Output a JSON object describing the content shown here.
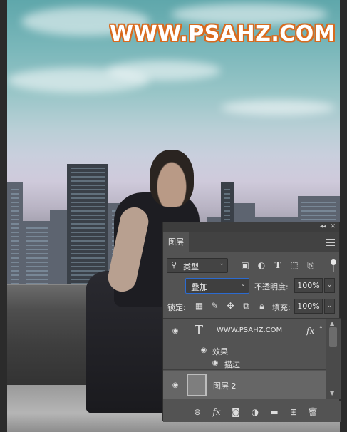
{
  "watermark": "WWW.PSAHZ.COM",
  "panel": {
    "tab": "图层",
    "filter": {
      "label": "类型",
      "icons": [
        "image-filter-icon",
        "adjustment-filter-icon",
        "type-filter-icon",
        "shape-filter-icon",
        "smart-object-filter-icon"
      ]
    },
    "blend_mode": "叠加",
    "opacity_label": "不透明度:",
    "opacity_value": "100%",
    "lock_label": "锁定:",
    "fill_label": "填充:",
    "fill_value": "100%",
    "layers": {
      "text_layer": {
        "name": "WWW.PSAHZ.COM",
        "fx": "fx"
      },
      "effects_label": "效果",
      "stroke_label": "描边",
      "layer2": {
        "name": "图层 2"
      }
    },
    "bottom_icons": [
      "link-layers-icon",
      "fx-icon",
      "add-mask-icon",
      "adjustment-layer-icon",
      "new-group-icon",
      "new-layer-icon",
      "delete-icon"
    ]
  },
  "colors": {
    "watermark_outline": "#d86a1e",
    "panel_bg": "#535353",
    "selected_layer_bg": "#666666",
    "focus_border": "#2c6bd0"
  }
}
